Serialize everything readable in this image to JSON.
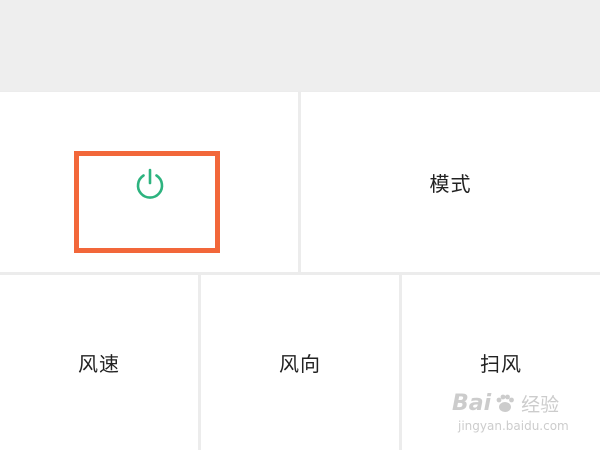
{
  "controls": {
    "power": {
      "icon": "power-icon",
      "icon_color": "#2db37f"
    },
    "mode_label": "模式",
    "speed_label": "风速",
    "direction_label": "风向",
    "sweep_label": "扫风"
  },
  "annotation": {
    "highlight_color": "#f2673a"
  },
  "watermark": {
    "brand": "Bai",
    "suffix": "经验",
    "url": "jingyan.baidu.com"
  }
}
